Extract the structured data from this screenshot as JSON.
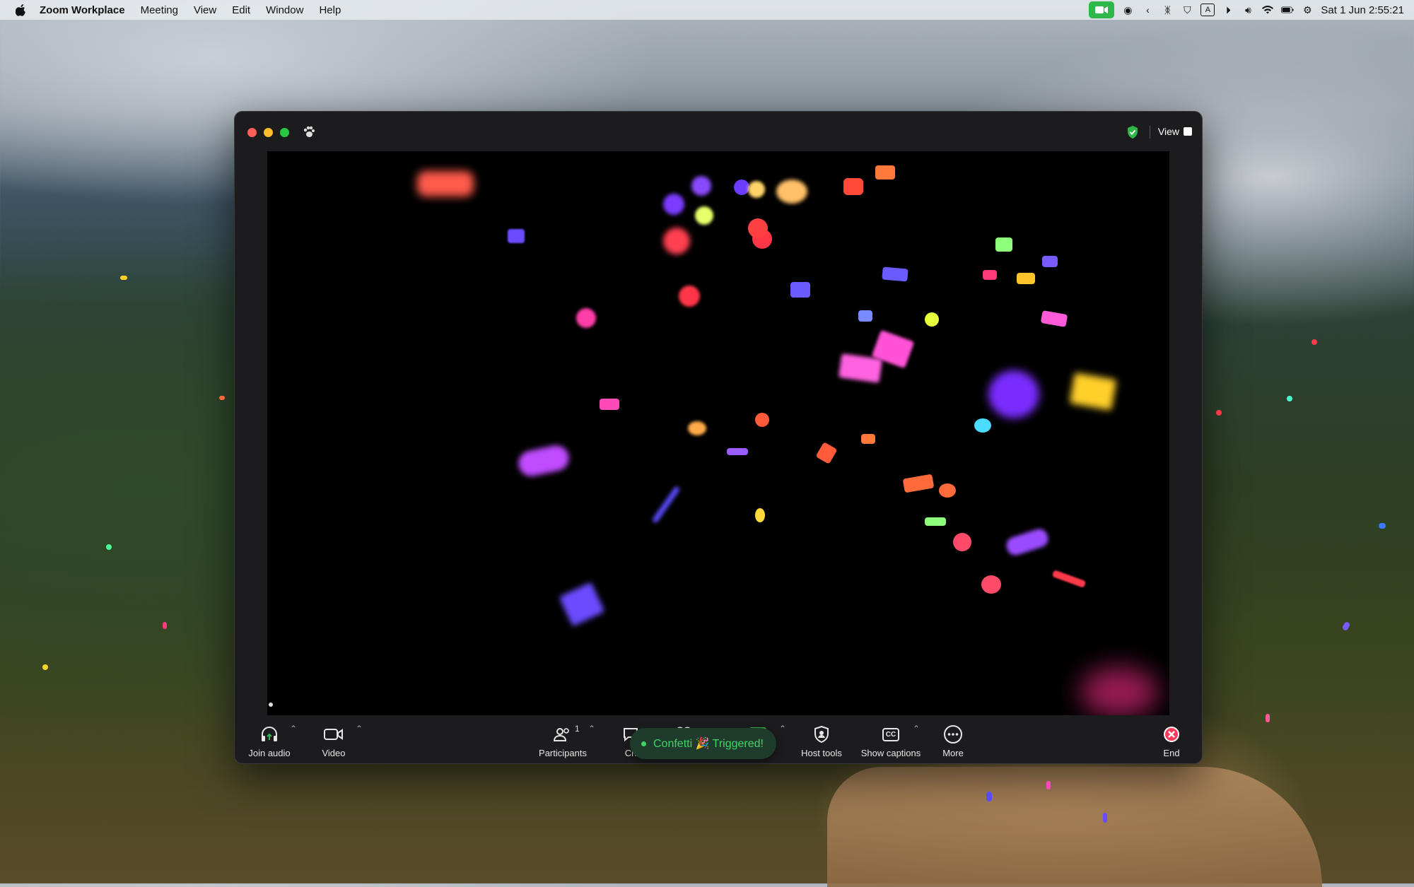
{
  "menubar": {
    "app_name": "Zoom Workplace",
    "items": [
      "Meeting",
      "View",
      "Edit",
      "Window",
      "Help"
    ],
    "clock": "Sat 1 Jun  2:55:21"
  },
  "window": {
    "view_label": "View"
  },
  "toolbar": {
    "join_audio": "Join audio",
    "video": "Video",
    "participants": "Participants",
    "participants_count": "1",
    "chat": "Ch",
    "host_tools": "Host tools",
    "show_captions": "Show captions",
    "captions_icon_text": "CC",
    "more": "More",
    "end": "End"
  },
  "toast": {
    "text": "Confetti 🎉 Triggered!"
  },
  "colors": {
    "accent_green": "#2fb84a",
    "end_red": "#ff3b5c",
    "toast_green": "#3fd46a"
  }
}
